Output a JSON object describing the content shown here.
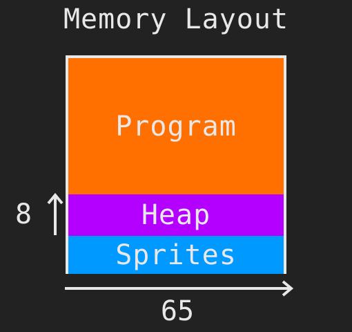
{
  "title": "Memory Layout",
  "segments": [
    {
      "label": "Program",
      "color": "#ff7000"
    },
    {
      "label": "Heap",
      "color": "#b300ff"
    },
    {
      "label": "Sprites",
      "color": "#0099ff"
    }
  ],
  "dimensions": {
    "height_label": "8",
    "width_label": "65"
  },
  "colors": {
    "background": "#222222",
    "foreground": "#e8e8e8"
  }
}
